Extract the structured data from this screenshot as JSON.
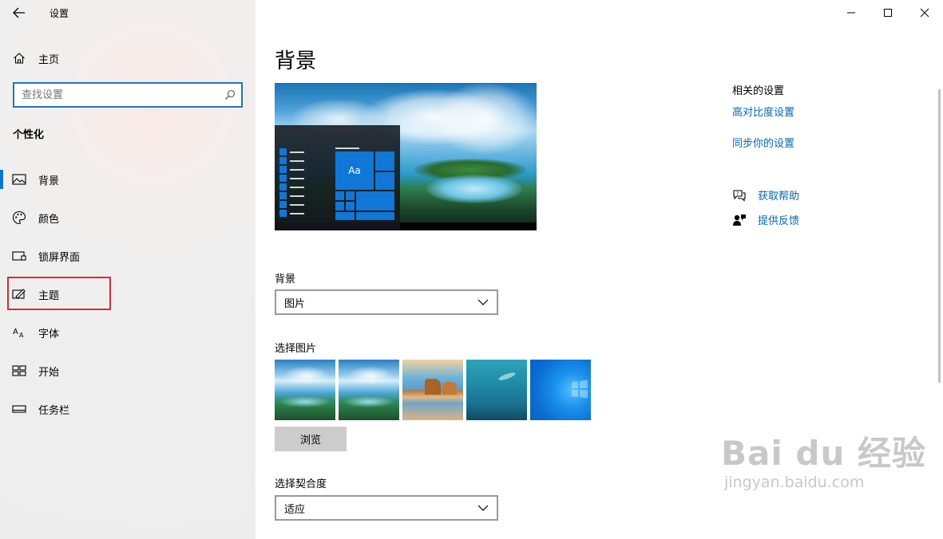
{
  "window": {
    "title": "设置",
    "controls": [
      "minimize",
      "maximize",
      "close"
    ]
  },
  "sidebar": {
    "home_label": "主页",
    "search": {
      "placeholder": "查找设置",
      "value": ""
    },
    "section_title": "个性化",
    "items": [
      {
        "label": "背景",
        "icon": "picture-icon",
        "selected": true
      },
      {
        "label": "颜色",
        "icon": "palette-icon",
        "selected": false
      },
      {
        "label": "锁屏界面",
        "icon": "lock-screen-icon",
        "selected": false
      },
      {
        "label": "主题",
        "icon": "theme-icon",
        "selected": false,
        "highlighted": true
      },
      {
        "label": "字体",
        "icon": "font-icon",
        "selected": false
      },
      {
        "label": "开始",
        "icon": "start-icon",
        "selected": false
      },
      {
        "label": "任务栏",
        "icon": "taskbar-icon",
        "selected": false
      }
    ]
  },
  "main": {
    "title": "背景",
    "preview": {
      "tile_text": "Aa"
    },
    "background_label": "背景",
    "background_value": "图片",
    "choose_picture_label": "选择图片",
    "thumbnails": [
      "nature",
      "nature",
      "beach",
      "underwater",
      "windows"
    ],
    "browse_label": "浏览",
    "fit_label": "选择契合度",
    "fit_value": "适应"
  },
  "related": {
    "title": "相关的设置",
    "links": [
      "高对比度设置",
      "同步你的设置"
    ],
    "help_label": "获取帮助",
    "feedback_label": "提供反馈"
  },
  "watermark": {
    "logo_text": "Bai du 经验",
    "url": "jingyan.baidu.com"
  },
  "colors": {
    "accent": "#0078d7",
    "link": "#0067b8",
    "highlight_box": "#d42c3a"
  }
}
